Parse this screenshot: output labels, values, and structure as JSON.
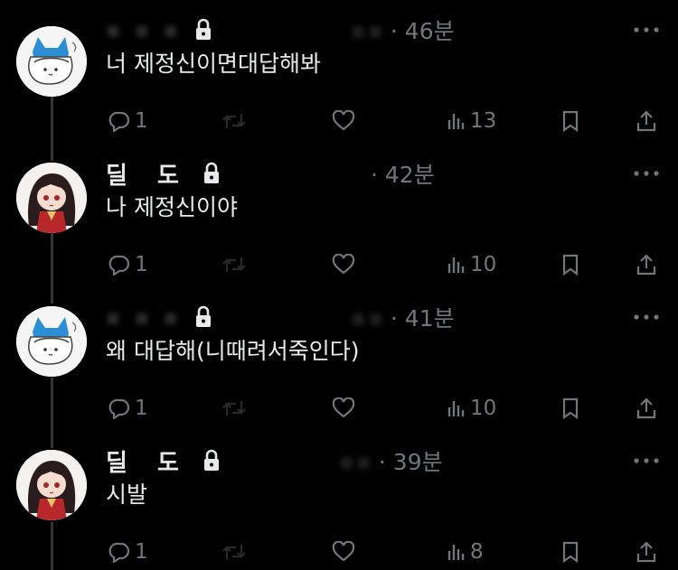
{
  "tweets": [
    {
      "name": "",
      "time": "· 46분",
      "text": "너 제정신이면대답해봐",
      "replies": "1",
      "views": "13",
      "avatar": "cat-avatar"
    },
    {
      "name": "딜 도",
      "time": "· 42분",
      "text": "나 제정신이야",
      "replies": "1",
      "views": "10",
      "avatar": "girl-avatar"
    },
    {
      "name": "",
      "time": "· 41분",
      "text": "왜 대답해(니때려서죽인다)",
      "replies": "1",
      "views": "10",
      "avatar": "cat-avatar"
    },
    {
      "name": "딜 도",
      "time": "· 39분",
      "text": "시발",
      "replies": "1",
      "views": "8",
      "avatar": "girl-avatar"
    }
  ],
  "colors": {
    "background": "#000000",
    "text": "#e7e9ea",
    "muted": "#71767b",
    "thread_line": "#333639"
  },
  "icons": [
    "reply-icon",
    "retweet-icon",
    "like-icon",
    "views-icon",
    "bookmark-icon",
    "share-icon",
    "more-icon",
    "lock-icon"
  ]
}
